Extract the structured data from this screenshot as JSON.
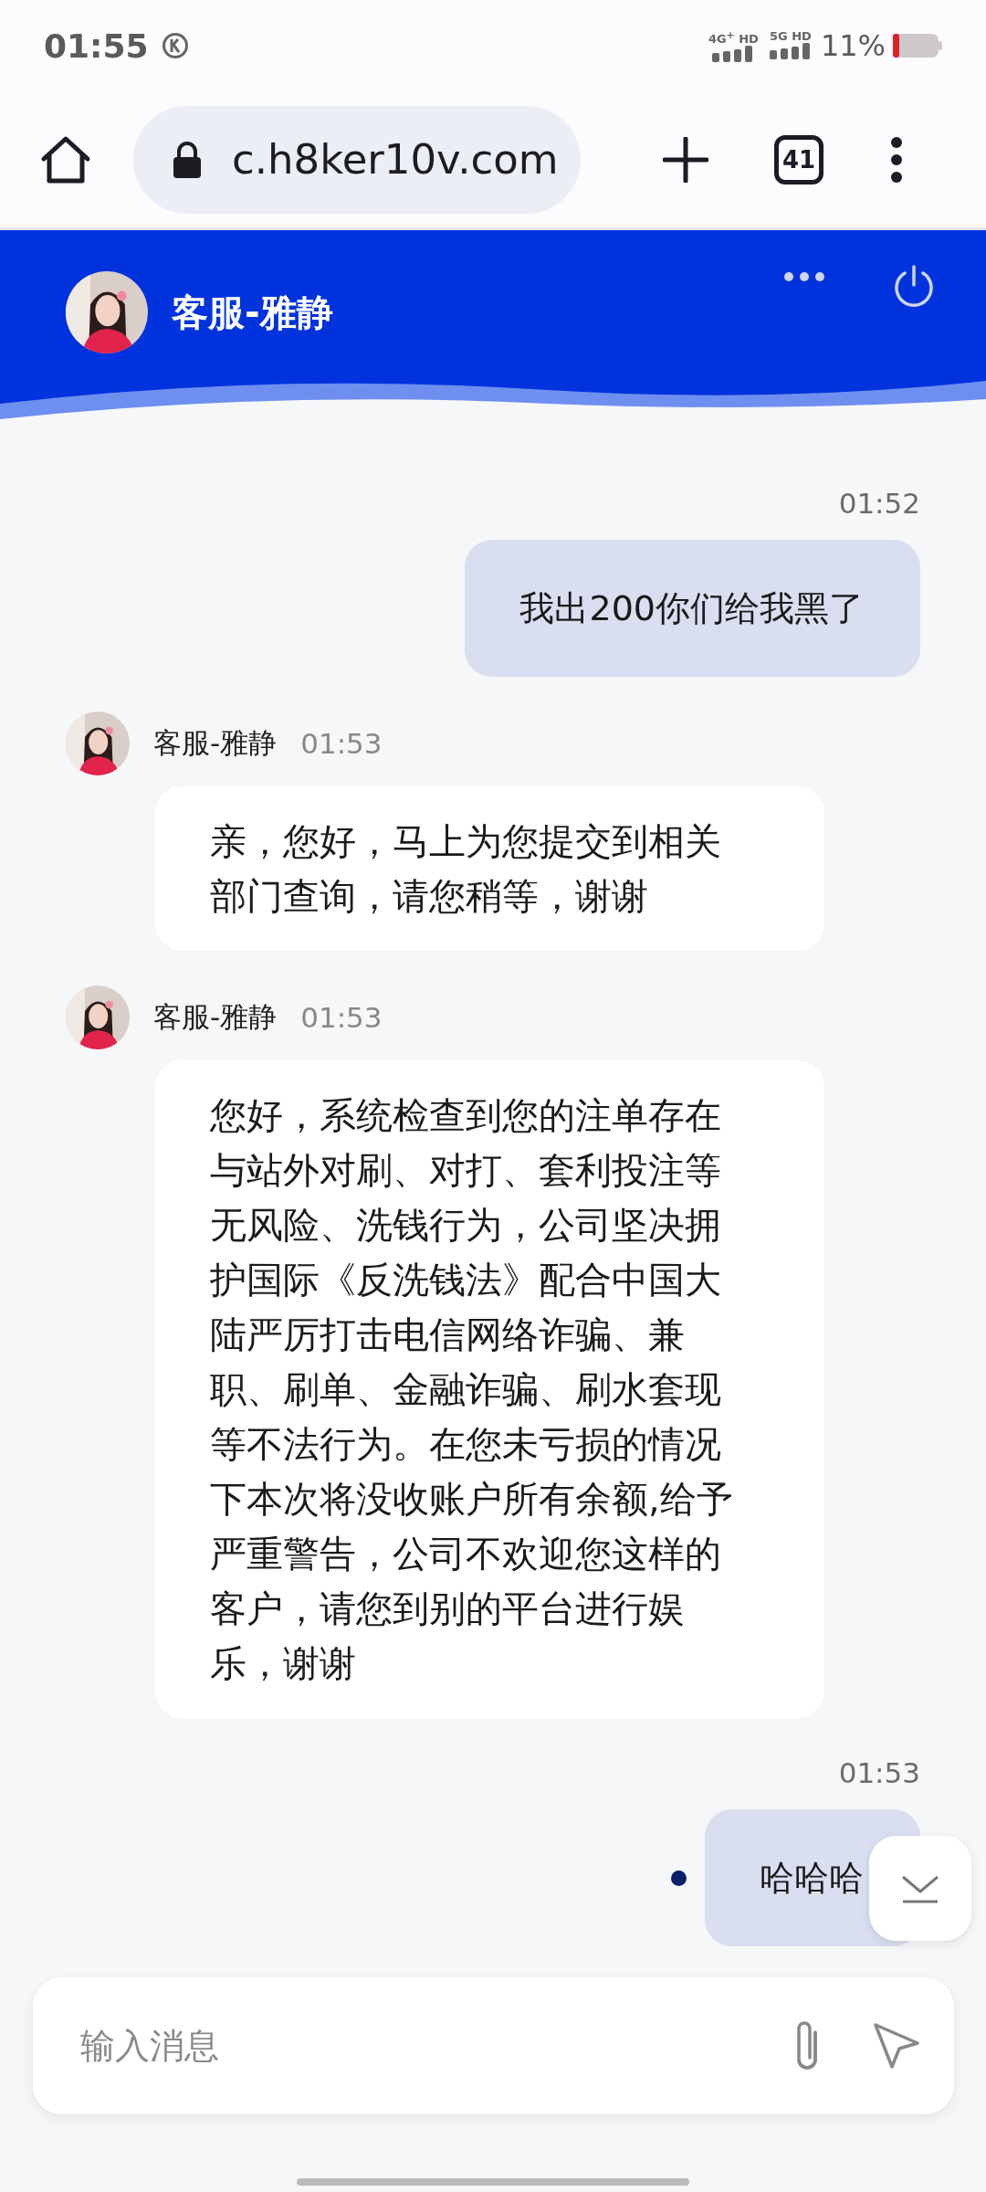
{
  "status_bar": {
    "time": "01:55",
    "networks": [
      {
        "label": "4G$^{+}$ HD"
      },
      {
        "label": "5G HD"
      }
    ],
    "battery": "11%"
  },
  "browser": {
    "url": "c.h8ker10v.com",
    "tab_count": "41"
  },
  "chat_header": {
    "agent_name": "客服-雅静"
  },
  "messages": [
    {
      "kind": "sent",
      "time": "01:52",
      "text": "我出200你们给我黑了",
      "pending": false
    },
    {
      "kind": "received",
      "sender": "客服-雅静",
      "time": "01:53",
      "text": "亲，您好，马上为您提交到相关部门查询，请您稍等，谢谢"
    },
    {
      "kind": "received",
      "sender": "客服-雅静",
      "time": "01:53",
      "text": "您好，系统检查到您的注单存在与站外对刷、对打、套利投注等无风险、洗钱行为，公司坚决拥护国际《反洗钱法》配合中国大陆严厉打击电信网络诈骗、兼职、刷单、金融诈骗、刷水套现等不法行为。在您未亏损的情况下本次将没收账户所有余额,给予严重警告，公司不欢迎您这样的客户，请您到别的平台进行娱乐，谢谢"
    },
    {
      "kind": "sent",
      "time": "01:53",
      "text": "哈哈哈",
      "pending": true
    }
  ],
  "composer": {
    "placeholder": "输入消息"
  }
}
